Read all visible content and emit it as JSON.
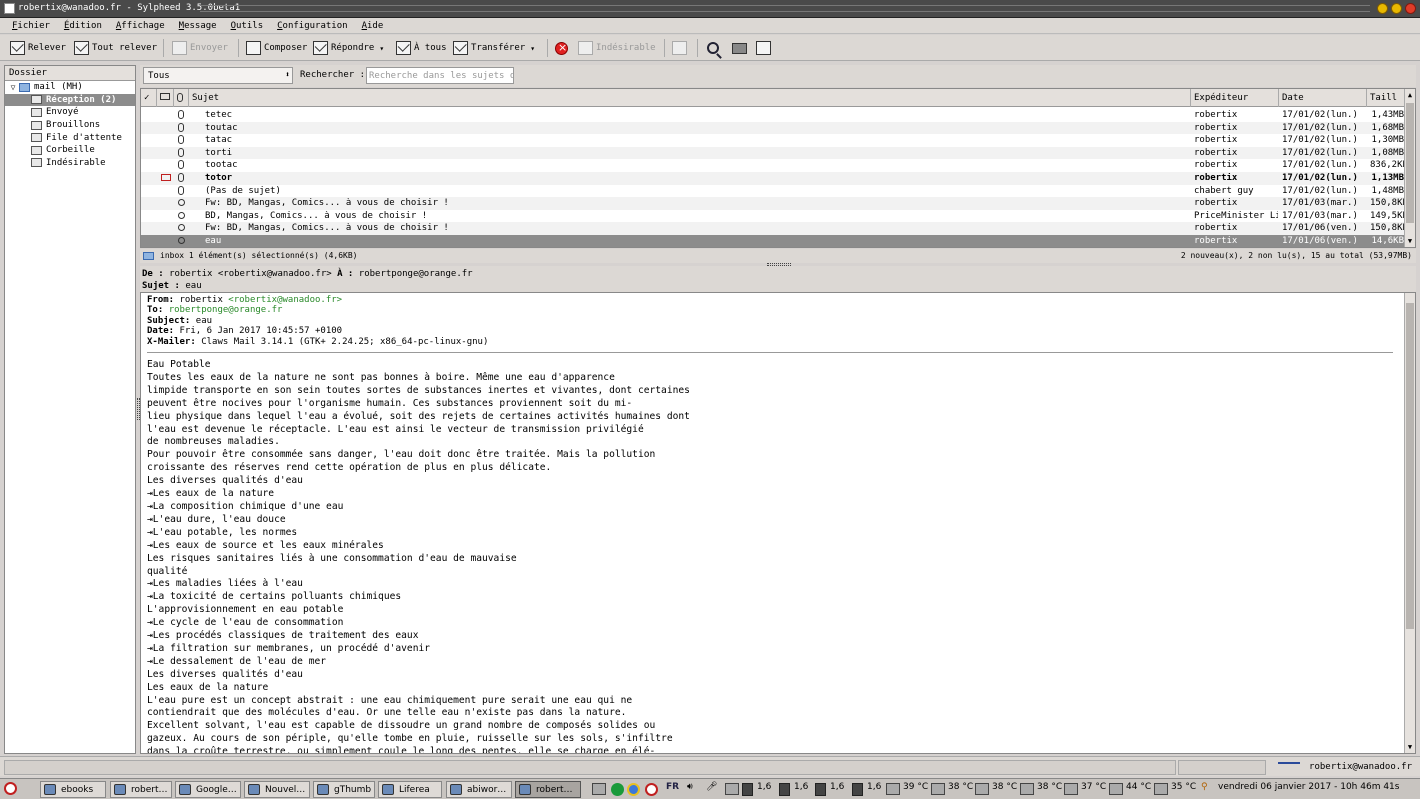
{
  "window": {
    "title": "robertix@wanadoo.fr - Sylpheed 3.5.0beta1"
  },
  "menu": [
    "Fichier",
    "Édition",
    "Affichage",
    "Message",
    "Outils",
    "Configuration",
    "Aide"
  ],
  "toolbar": {
    "relever": "Relever",
    "tout_relever": "Tout relever",
    "envoyer": "Envoyer",
    "composer": "Composer",
    "repondre": "Répondre",
    "a_tous": "À tous",
    "transferer": "Transférer",
    "indesirable": "Indésirable"
  },
  "folders": {
    "header": "Dossier",
    "root": "mail (MH)",
    "items": [
      {
        "label": "Réception (2)",
        "icon": "inbox-icon",
        "selected": true
      },
      {
        "label": "Envoyé",
        "icon": "sent-icon"
      },
      {
        "label": "Brouillons",
        "icon": "drafts-icon"
      },
      {
        "label": "File d'attente",
        "icon": "queue-icon"
      },
      {
        "label": "Corbeille",
        "icon": "trash-icon"
      },
      {
        "label": "Indésirable",
        "icon": "junk-icon"
      }
    ]
  },
  "filter": {
    "selected": "Tous",
    "search_label": "Rechercher :",
    "search_placeholder": "Recherche dans les sujets ou"
  },
  "list": {
    "columns": [
      "Sujet",
      "Expéditeur",
      "Date",
      "Taill"
    ],
    "rows": [
      {
        "subject": "tetec",
        "from": "robertix",
        "date": "17/01/02(lun.)",
        "size": "1,43MB",
        "icon": "clip"
      },
      {
        "subject": "toutac",
        "from": "robertix",
        "date": "17/01/02(lun.)",
        "size": "1,68MB",
        "icon": "clip"
      },
      {
        "subject": "tatac",
        "from": "robertix",
        "date": "17/01/02(lun.)",
        "size": "1,30MB",
        "icon": "clip"
      },
      {
        "subject": "torti",
        "from": "robertix",
        "date": "17/01/02(lun.)",
        "size": "1,08MB",
        "icon": "clip"
      },
      {
        "subject": "tootac",
        "from": "robertix",
        "date": "17/01/02(lun.)",
        "size": "836,2KB",
        "icon": "clip"
      },
      {
        "subject": "totor",
        "from": "robertix",
        "date": "17/01/02(lun.)",
        "size": "1,13MB",
        "icon": "clip",
        "unread": true
      },
      {
        "subject": "(Pas de sujet)",
        "from": "chabert guy",
        "date": "17/01/02(lun.)",
        "size": "1,48MB",
        "icon": "clip"
      },
      {
        "subject": "Fw: BD, Mangas, Comics... à vous de choisir !",
        "from": "robertix",
        "date": "17/01/03(mar.)",
        "size": "150,8KB",
        "icon": "dot"
      },
      {
        "subject": "BD, Mangas, Comics... à vous de choisir !",
        "from": "PriceMinister Liv",
        "date": "17/01/03(mar.)",
        "size": "149,5KB",
        "icon": "dot"
      },
      {
        "subject": "Fw: BD, Mangas, Comics... à vous de choisir !",
        "from": "robertix",
        "date": "17/01/06(ven.)",
        "size": "150,8KB",
        "icon": "dot"
      },
      {
        "subject": "eau",
        "from": "robertix",
        "date": "17/01/06(ven.)",
        "size": "14,6KB",
        "icon": "dot",
        "selected": true
      }
    ]
  },
  "status": {
    "left": "inbox    1 élément(s) sélectionné(s) (4,6KB)",
    "right": "2 nouveau(x), 2 non lu(s), 15 au total (53,97MB)"
  },
  "summary": {
    "from_label": "De :",
    "from": "robertix <robertix@wanadoo.fr>",
    "to_label": "À :",
    "to": "robertponge@orange.fr",
    "subject_label": "Sujet :",
    "subject": "eau"
  },
  "message": {
    "from_label": "From:",
    "from_name": "robertix",
    "from_addr": "<robertix@wanadoo.fr>",
    "to_label": "To:",
    "to": "robertponge@orange.fr",
    "subject_label": "Subject:",
    "subject": "eau",
    "date_label": "Date:",
    "date": "Fri, 6 Jan 2017 10:45:57 +0100",
    "mailer_label": "X-Mailer:",
    "mailer": "Claws Mail 3.14.1 (GTK+ 2.24.25; x86_64-pc-linux-gnu)",
    "body": "Eau Potable\nToutes les eaux de la nature ne sont pas bonnes à boire. Même une eau d'apparence\nlimpide transporte en son sein toutes sortes de substances inertes et vivantes, dont certaines\npeuvent être nocives pour l'organisme humain. Ces substances proviennent soit du mi-\nlieu physique dans lequel l'eau a évolué, soit des rejets de certaines activités humaines dont\nl'eau est devenue le réceptacle. L'eau est ainsi le vecteur de transmission privilégié\nde nombreuses maladies.\nPour pouvoir être consommée sans danger, l'eau doit donc être traitée. Mais la pollution\ncroissante des réserves rend cette opération de plus en plus délicate.\nLes diverses qualités d'eau\n⇥Les eaux de la nature\n⇥La composition chimique d'une eau\n⇥L'eau dure, l'eau douce\n⇥L'eau potable, les normes\n⇥Les eaux de source et les eaux minérales\nLes risques sanitaires liés à une consommation d'eau de mauvaise\nqualité\n⇥Les maladies liées à l'eau\n⇥La toxicité de certains polluants chimiques\nL'approvisionnement en eau potable\n⇥Le cycle de l'eau de consommation\n⇥Les procédés classiques de traitement des eaux\n⇥La filtration sur membranes, un procédé d'avenir\n⇥Le dessalement de l'eau de mer\nLes diverses qualités d'eau\nLes eaux de la nature\nL'eau pure est un concept abstrait : une eau chimiquement pure serait une eau qui ne\ncontiendrait que des molécules d'eau. Or une telle eau n'existe pas dans la nature.\nExcellent solvant, l'eau est capable de dissoudre un grand nombre de composés solides ou\ngazeux. Au cours de son périple, qu'elle tombe en pluie, ruisselle sur les sols, s'infiltre\ndans la croûte terrestre, ou simplement coule le long des pentes, elle se charge en élé-"
  },
  "appstatus": {
    "account": "robertix@wanadoo.fr"
  },
  "taskbar": {
    "buttons": [
      "ebooks",
      "robert…",
      "Google…",
      "Nouvel…",
      "gThumb",
      "Liferea",
      "abiwor…",
      "robert…"
    ],
    "active_index": 7,
    "lang": "FR",
    "cpu": [
      "1,6",
      "1,6",
      "1,6",
      "1,6"
    ],
    "temps": [
      "39 °C",
      "38 °C",
      "38 °C",
      "38 °C",
      "37 °C",
      "44 °C",
      "35 °C"
    ],
    "clock": "vendredi 06 janvier 2017 - 10h 46m 41s"
  }
}
